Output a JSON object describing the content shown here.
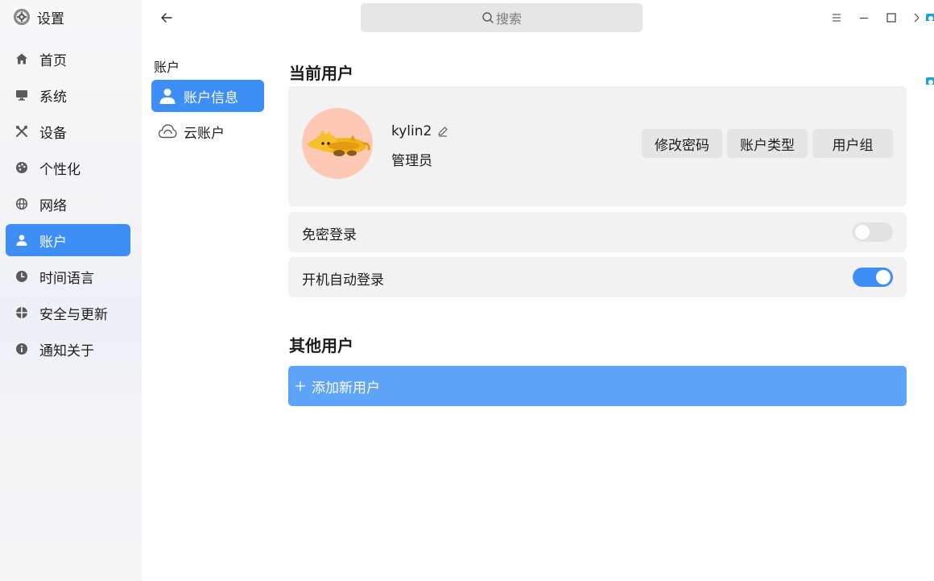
{
  "app": {
    "title": "设置",
    "icon": "gear-icon"
  },
  "sidebar": {
    "items": [
      {
        "label": "首页",
        "icon": "home-icon",
        "active": false
      },
      {
        "label": "系统",
        "icon": "monitor-icon",
        "active": false
      },
      {
        "label": "设备",
        "icon": "tools-icon",
        "active": false
      },
      {
        "label": "个性化",
        "icon": "palette-icon",
        "active": false
      },
      {
        "label": "网络",
        "icon": "globe-icon",
        "active": false
      },
      {
        "label": "账户",
        "icon": "user-icon",
        "active": true
      },
      {
        "label": "时间语言",
        "icon": "clock-icon",
        "active": false
      },
      {
        "label": "安全与更新",
        "icon": "shield-icon",
        "active": false
      },
      {
        "label": "通知关于",
        "icon": "info-icon",
        "active": false
      }
    ]
  },
  "topbar": {
    "search_placeholder": "搜索",
    "controls": [
      "menu-icon",
      "minimize-icon",
      "maximize-icon",
      "close-icon"
    ]
  },
  "subnav": {
    "title": "账户",
    "items": [
      {
        "label": "账户信息",
        "icon": "user-icon",
        "active": true
      },
      {
        "label": "云账户",
        "icon": "cloud-icon",
        "active": false
      }
    ]
  },
  "current_user": {
    "section_title": "当前用户",
    "username": "kylin2",
    "role": "管理员",
    "buttons": {
      "change_password": "修改密码",
      "account_type": "账户类型",
      "user_group": "用户组"
    }
  },
  "settings": {
    "passwordless_login": {
      "label": "免密登录",
      "enabled": false
    },
    "auto_login": {
      "label": "开机自动登录",
      "enabled": true
    }
  },
  "other_users": {
    "section_title": "其他用户",
    "add_user_label": "添加新用户"
  },
  "colors": {
    "accent": "#3d8ef5",
    "add_button": "#5ea4f8",
    "card_bg": "#f2f2f2",
    "avatar_bg": "#fdc9b4"
  }
}
